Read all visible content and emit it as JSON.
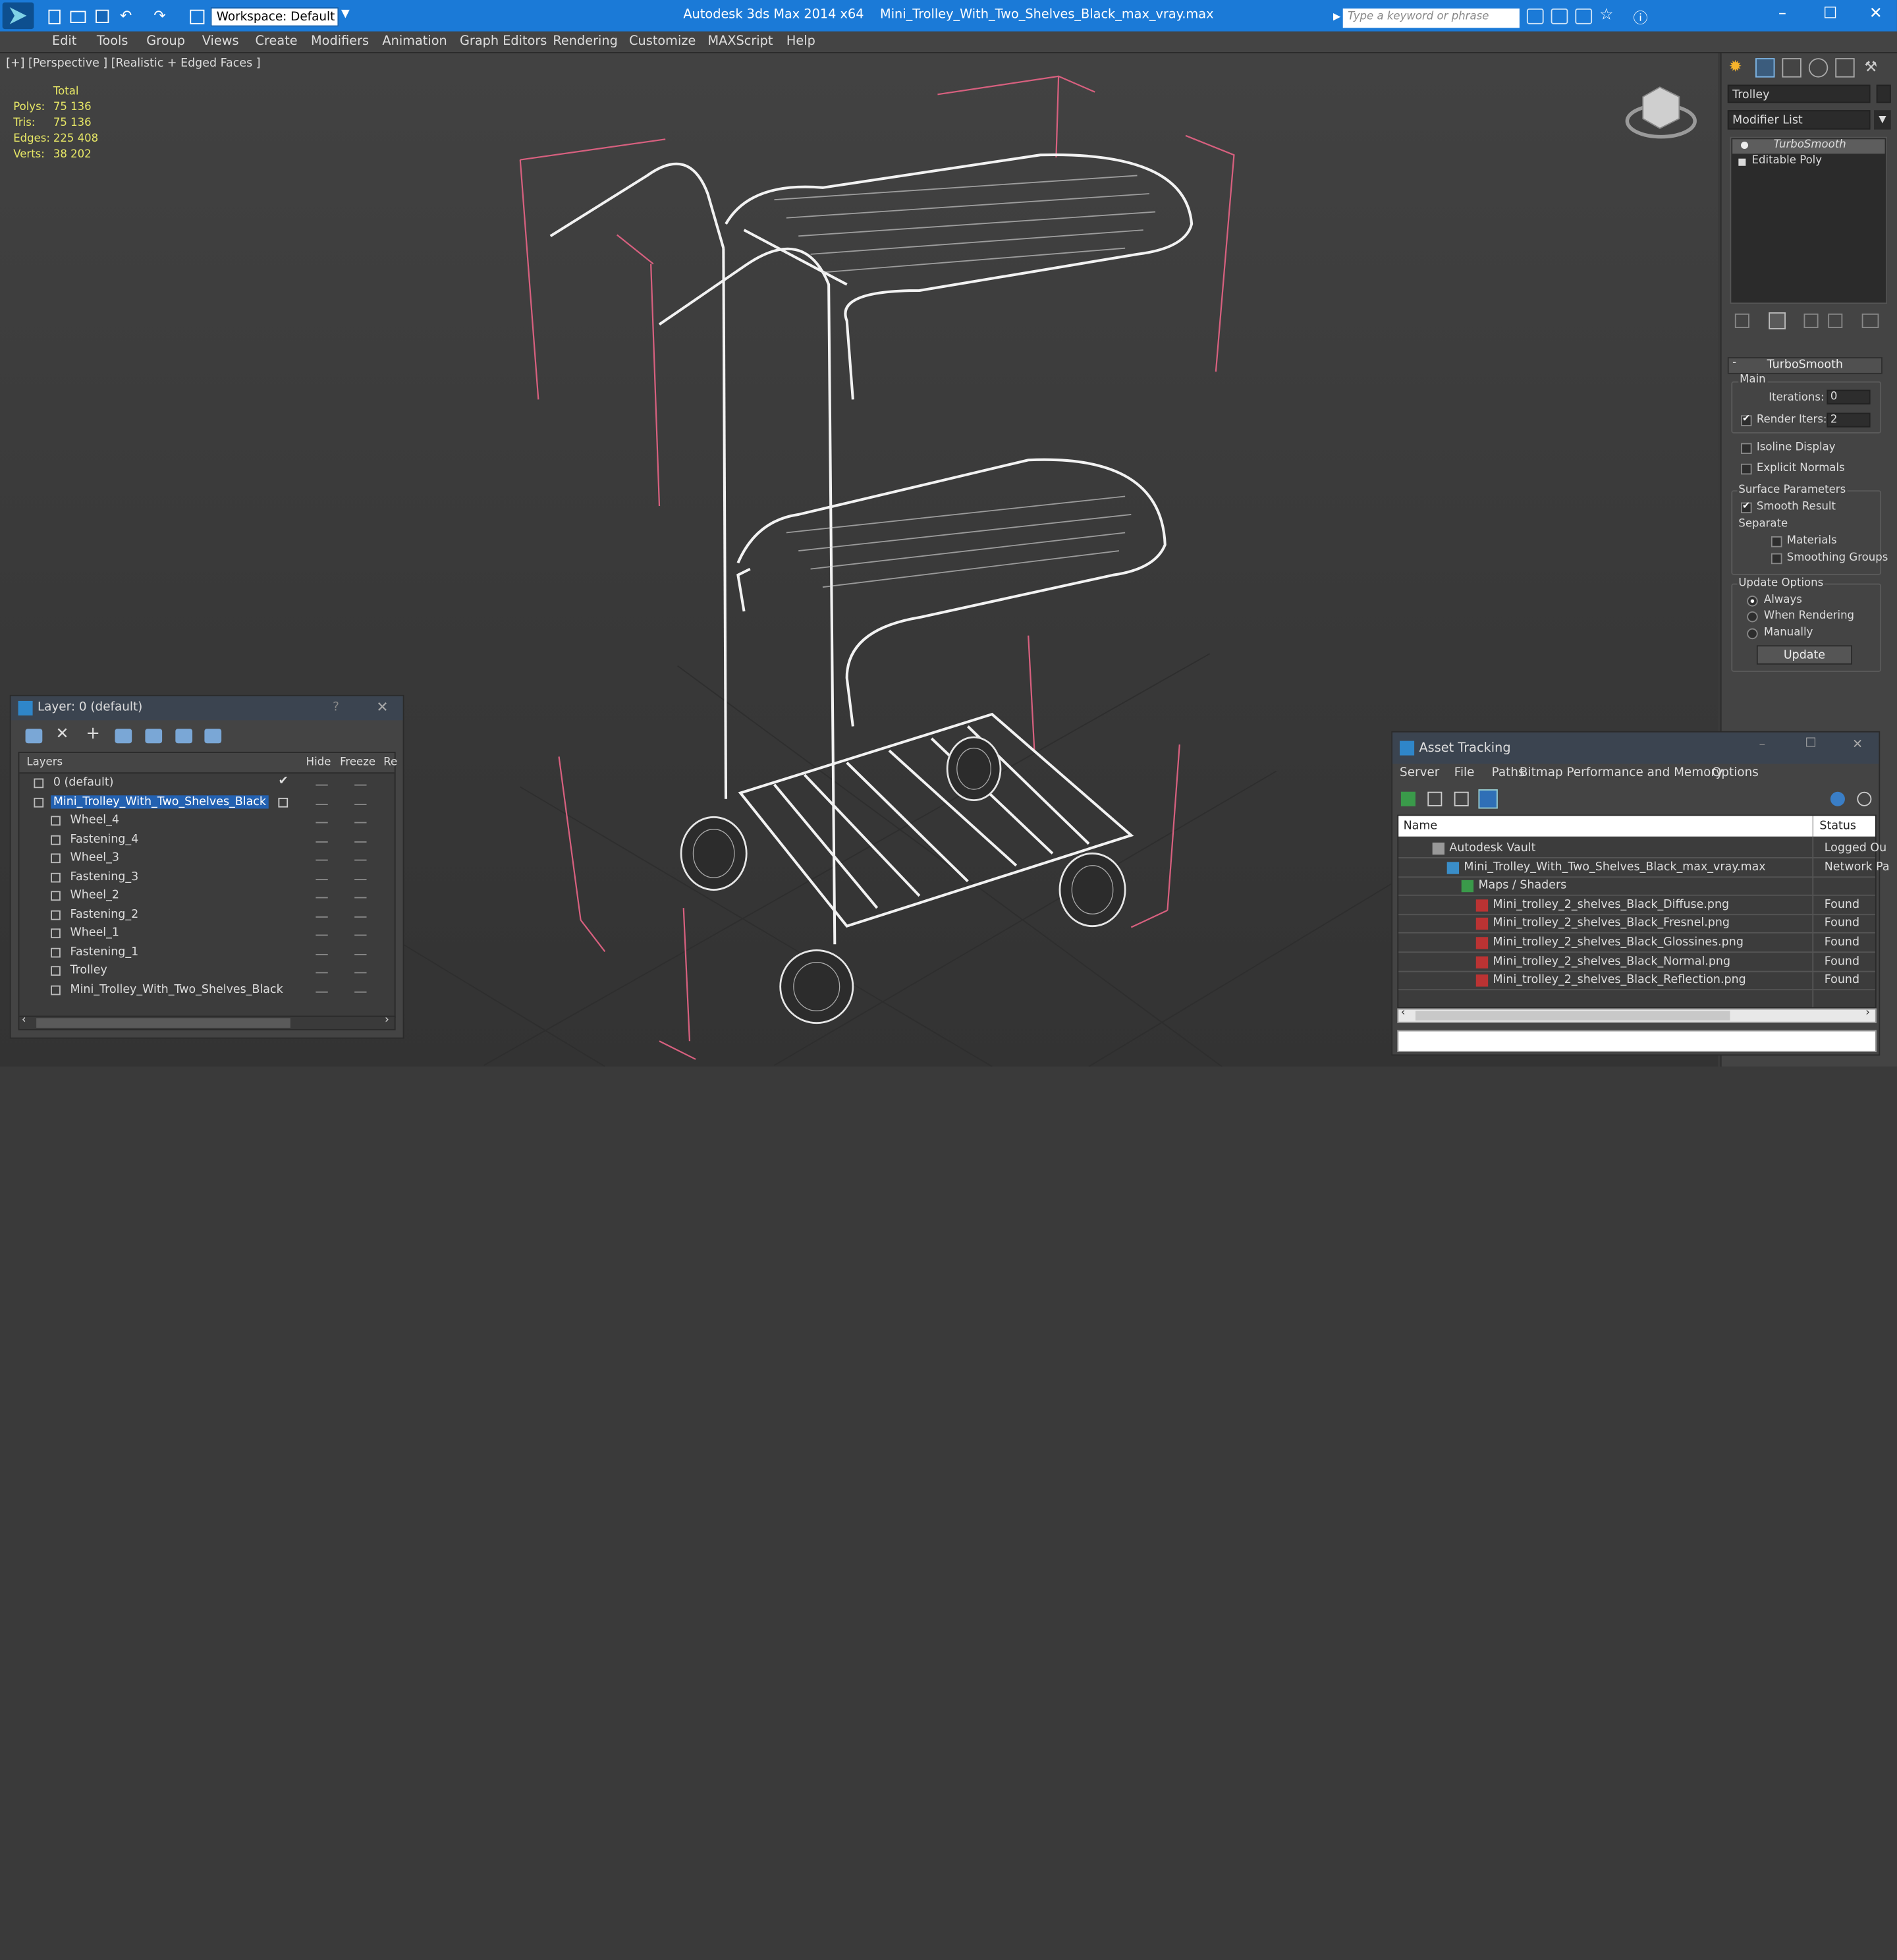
{
  "titlebar": {
    "app_title": "Autodesk 3ds Max  2014 x64",
    "file_title": "Mini_Trolley_With_Two_Shelves_Black_max_vray.max",
    "workspace": "Workspace: Default",
    "search_placeholder": "Type a keyword or phrase"
  },
  "menu": [
    "Edit",
    "Tools",
    "Group",
    "Views",
    "Create",
    "Modifiers",
    "Animation",
    "Graph Editors",
    "Rendering",
    "Customize",
    "MAXScript",
    "Help"
  ],
  "viewport": {
    "label": "[+] [Perspective ] [Realistic + Edged Faces ]",
    "stats_header": "Total",
    "stats": [
      {
        "label": "Polys:",
        "value": "75 136"
      },
      {
        "label": "Tris:",
        "value": "75 136"
      },
      {
        "label": "Edges:",
        "value": "225 408"
      },
      {
        "label": "Verts:",
        "value": "38 202"
      }
    ]
  },
  "command_panel": {
    "object_name": "Trolley",
    "modifier_list": "Modifier List",
    "stack": [
      "TurboSmooth",
      "Editable Poly"
    ],
    "rollout_title": "TurboSmooth",
    "main_label": "Main",
    "iterations_label": "Iterations:",
    "iterations_value": "0",
    "render_iters_label": "Render Iters:",
    "render_iters_value": "2",
    "isoline": "Isoline Display",
    "explicit_normals": "Explicit Normals",
    "surface_params": "Surface Parameters",
    "smooth_result": "Smooth Result",
    "separate": "Separate",
    "materials": "Materials",
    "smoothing_groups": "Smoothing Groups",
    "update_options": "Update Options",
    "always": "Always",
    "when_rendering": "When Rendering",
    "manually": "Manually",
    "update_btn": "Update"
  },
  "layer_window": {
    "title": "Layer: 0 (default)",
    "help": "?",
    "col_layers": "Layers",
    "col_hide": "Hide",
    "col_freeze": "Freeze",
    "col_r": "Re",
    "rows": [
      {
        "name": "0 (default)",
        "indent": 0
      },
      {
        "name": "Mini_Trolley_With_Two_Shelves_Black",
        "indent": 0
      },
      {
        "name": "Wheel_4",
        "indent": 1
      },
      {
        "name": "Fastening_4",
        "indent": 1
      },
      {
        "name": "Wheel_3",
        "indent": 1
      },
      {
        "name": "Fastening_3",
        "indent": 1
      },
      {
        "name": "Wheel_2",
        "indent": 1
      },
      {
        "name": "Fastening_2",
        "indent": 1
      },
      {
        "name": "Wheel_1",
        "indent": 1
      },
      {
        "name": "Fastening_1",
        "indent": 1
      },
      {
        "name": "Trolley",
        "indent": 1
      },
      {
        "name": "Mini_Trolley_With_Two_Shelves_Black",
        "indent": 1
      }
    ]
  },
  "asset_window": {
    "title": "Asset Tracking",
    "menu": [
      "Server",
      "File",
      "Paths",
      "Bitmap Performance and Memory",
      "Options"
    ],
    "col_name": "Name",
    "col_status": "Status",
    "rows": [
      {
        "name": "Autodesk Vault",
        "status": "Logged Ou",
        "indent": 1
      },
      {
        "name": "Mini_Trolley_With_Two_Shelves_Black_max_vray.max",
        "status": "Network Pa",
        "indent": 2
      },
      {
        "name": "Maps / Shaders",
        "status": "",
        "indent": 3
      },
      {
        "name": "Mini_trolley_2_shelves_Black_Diffuse.png",
        "status": "Found",
        "indent": 4
      },
      {
        "name": "Mini_trolley_2_shelves_Black_Fresnel.png",
        "status": "Found",
        "indent": 4
      },
      {
        "name": "Mini_trolley_2_shelves_Black_Glossines.png",
        "status": "Found",
        "indent": 4
      },
      {
        "name": "Mini_trolley_2_shelves_Black_Normal.png",
        "status": "Found",
        "indent": 4
      },
      {
        "name": "Mini_trolley_2_shelves_Black_Reflection.png",
        "status": "Found",
        "indent": 4
      }
    ]
  }
}
